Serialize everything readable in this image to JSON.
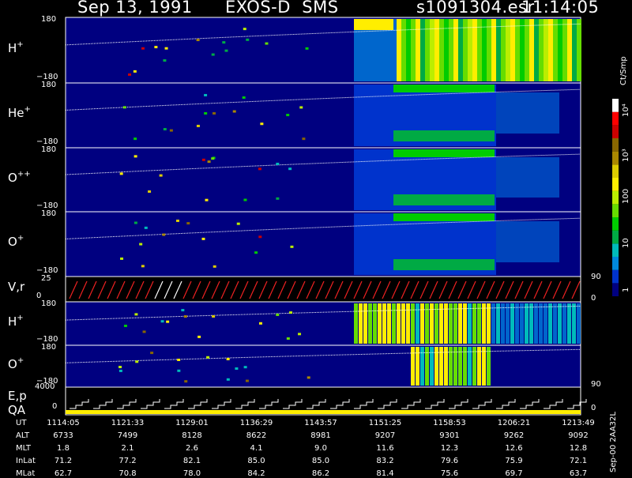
{
  "header": {
    "date": "Sep 13, 1991",
    "instrument": "EXOS-D  SMS",
    "file": "s1091304.esr",
    "time": "11:14:05"
  },
  "panels": [
    {
      "species": "H",
      "charge": "+",
      "top_tick": "180",
      "bottom_tick": "−180"
    },
    {
      "species": "He",
      "charge": "+",
      "top_tick": "180",
      "bottom_tick": "−180"
    },
    {
      "species": "O",
      "charge": "++",
      "top_tick": "180",
      "bottom_tick": "−180"
    },
    {
      "species": "O",
      "charge": "+",
      "top_tick": "180",
      "bottom_tick": "−180"
    },
    {
      "species": "V,r",
      "charge": "",
      "top_tick": "25",
      "bottom_tick": "0"
    },
    {
      "species": "H",
      "charge": "+",
      "top_tick": "180",
      "bottom_tick": "−180"
    },
    {
      "species": "O",
      "charge": "+",
      "top_tick": "180",
      "bottom_tick": "−180"
    }
  ],
  "ep_panel": {
    "label1": "E,p",
    "label2": "QA",
    "top_tick": "4000",
    "bottom_tick": "0"
  },
  "right_axis": {
    "unit": "Ct/Smp",
    "ticks": [
      "10⁴",
      "10³",
      "100",
      "10",
      "1"
    ],
    "ticks_mark_90_a": "90",
    "ticks_mark_90_b": "90",
    "ticks_mark_0": "0",
    "ticks_mark_0_ep": "0",
    "version": "Sep-00  2AA32L",
    "colors": [
      "#000080",
      "#0033cc",
      "#0088dd",
      "#00bbbb",
      "#00aa44",
      "#00cc00",
      "#66dd00",
      "#bbee00",
      "#ffee00",
      "#ddcc00",
      "#aa8800",
      "#886600",
      "#cc0000",
      "#ff0000",
      "#ffffff"
    ]
  },
  "table": {
    "row_labels": [
      "UT",
      "ALT",
      "MLT",
      "InLat",
      "MLat"
    ],
    "columns": [
      [
        "1114:05",
        "6733",
        "1.8",
        "71.2",
        "62.7"
      ],
      [
        "1121:33",
        "7499",
        "2.1",
        "77.2",
        "70.8"
      ],
      [
        "1129:01",
        "8128",
        "2.6",
        "82.1",
        "78.0"
      ],
      [
        "1136:29",
        "8622",
        "4.1",
        "85.0",
        "84.2"
      ],
      [
        "1143:57",
        "8981",
        "9.0",
        "85.0",
        "86.2"
      ],
      [
        "1151:25",
        "9207",
        "11.6",
        "83.2",
        "81.4"
      ],
      [
        "1158:53",
        "9301",
        "12.3",
        "79.6",
        "75.6"
      ],
      [
        "1206:21",
        "9262",
        "12.6",
        "75.9",
        "69.7"
      ],
      [
        "1213:49",
        "9092",
        "12.8",
        "72.1",
        "63.7"
      ]
    ]
  },
  "chart_data": {
    "type": "heatmap",
    "x_ticks": [
      "1114:05",
      "1121:33",
      "1129:01",
      "1136:29",
      "1143:57",
      "1151:25",
      "1158:53",
      "1206:21",
      "1213:49"
    ],
    "y_range": [
      -180,
      180
    ],
    "colorbar": {
      "label": "Ct/Smp",
      "ticks": [
        "1",
        "10",
        "100",
        "10³",
        "10⁴"
      ],
      "log": true
    }
  }
}
